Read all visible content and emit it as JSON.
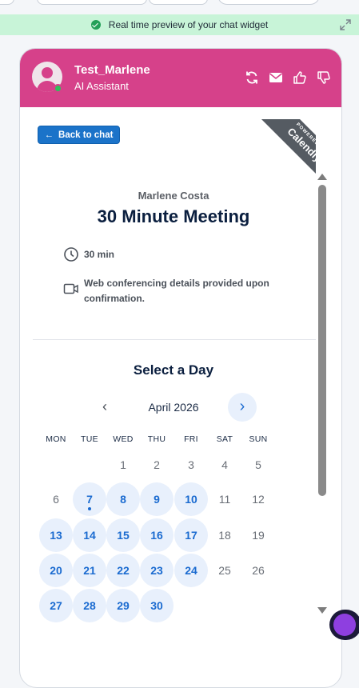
{
  "preview_bar": {
    "text": "Real time preview of your chat widget"
  },
  "header": {
    "bot_name": "Test_Marlene",
    "bot_role": "AI Assistant",
    "accent_color": "#d6418a",
    "icons": [
      "refresh-icon",
      "mail-icon",
      "thumbs-up-icon",
      "thumbs-down-icon"
    ]
  },
  "booking": {
    "back_label": "Back to chat",
    "ribbon_powered": "POWERED BY",
    "ribbon_brand": "Calendly",
    "organizer": "Marlene Costa",
    "title": "30 Minute Meeting",
    "duration": "30 min",
    "conferencing": "Web conferencing details provided upon confirmation."
  },
  "calendar": {
    "heading": "Select a Day",
    "month": "April 2026",
    "weekdays": [
      "MON",
      "TUE",
      "WED",
      "THU",
      "FRI",
      "SAT",
      "SUN"
    ],
    "days": [
      {
        "n": "1",
        "available": false
      },
      {
        "n": "2",
        "available": false
      },
      {
        "n": "3",
        "available": false
      },
      {
        "n": "4",
        "available": false
      },
      {
        "n": "5",
        "available": false
      },
      {
        "n": "6",
        "available": false
      },
      {
        "n": "7",
        "available": true,
        "today": true
      },
      {
        "n": "8",
        "available": true
      },
      {
        "n": "9",
        "available": true
      },
      {
        "n": "10",
        "available": true
      },
      {
        "n": "11",
        "available": false
      },
      {
        "n": "12",
        "available": false
      },
      {
        "n": "13",
        "available": true
      },
      {
        "n": "14",
        "available": true
      },
      {
        "n": "15",
        "available": true
      },
      {
        "n": "16",
        "available": true
      },
      {
        "n": "17",
        "available": true
      },
      {
        "n": "18",
        "available": false
      },
      {
        "n": "19",
        "available": false
      },
      {
        "n": "20",
        "available": true
      },
      {
        "n": "21",
        "available": true
      },
      {
        "n": "22",
        "available": true
      },
      {
        "n": "23",
        "available": true
      },
      {
        "n": "24",
        "available": true
      },
      {
        "n": "25",
        "available": false
      },
      {
        "n": "26",
        "available": false
      },
      {
        "n": "27",
        "available": true
      },
      {
        "n": "28",
        "available": true
      },
      {
        "n": "29",
        "available": true
      },
      {
        "n": "30",
        "available": true
      }
    ]
  }
}
